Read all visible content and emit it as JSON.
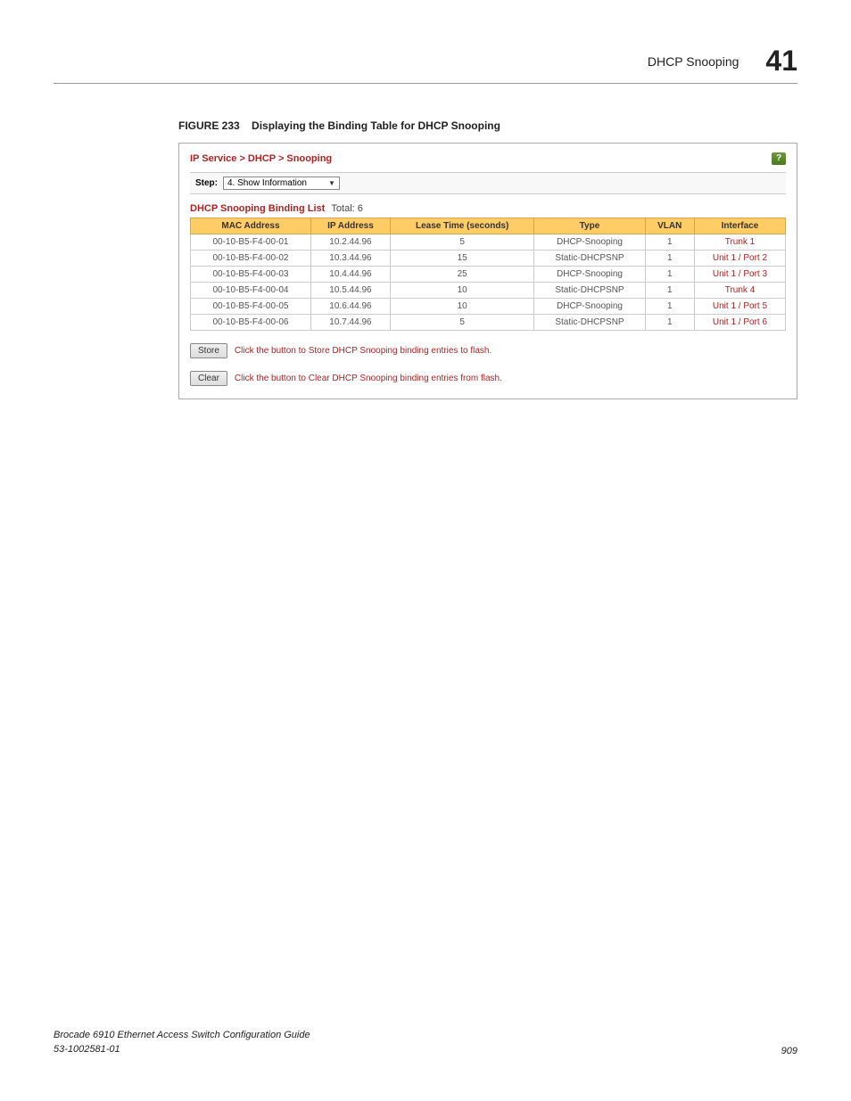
{
  "header": {
    "title": "DHCP Snooping",
    "chapter": "41"
  },
  "figure": {
    "label": "FIGURE 233",
    "caption": "Displaying the Binding Table for DHCP Snooping"
  },
  "panel": {
    "breadcrumb": "IP Service > DHCP > Snooping",
    "help_icon": "?",
    "step_label": "Step:",
    "step_value": "4. Show Information",
    "list_title": "DHCP Snooping Binding List",
    "list_total": "Total: 6",
    "columns": {
      "mac": "MAC Address",
      "ip": "IP Address",
      "lease": "Lease Time (seconds)",
      "type": "Type",
      "vlan": "VLAN",
      "iface": "Interface"
    },
    "rows": [
      {
        "mac": "00-10-B5-F4-00-01",
        "ip": "10.2.44.96",
        "lease": "5",
        "type": "DHCP-Snooping",
        "vlan": "1",
        "iface": "Trunk 1"
      },
      {
        "mac": "00-10-B5-F4-00-02",
        "ip": "10.3.44.96",
        "lease": "15",
        "type": "Static-DHCPSNP",
        "vlan": "1",
        "iface": "Unit 1 / Port 2"
      },
      {
        "mac": "00-10-B5-F4-00-03",
        "ip": "10.4.44.96",
        "lease": "25",
        "type": "DHCP-Snooping",
        "vlan": "1",
        "iface": "Unit 1 / Port 3"
      },
      {
        "mac": "00-10-B5-F4-00-04",
        "ip": "10.5.44.96",
        "lease": "10",
        "type": "Static-DHCPSNP",
        "vlan": "1",
        "iface": "Trunk 4"
      },
      {
        "mac": "00-10-B5-F4-00-05",
        "ip": "10.6.44.96",
        "lease": "10",
        "type": "DHCP-Snooping",
        "vlan": "1",
        "iface": "Unit 1 / Port 5"
      },
      {
        "mac": "00-10-B5-F4-00-06",
        "ip": "10.7.44.96",
        "lease": "5",
        "type": "Static-DHCPSNP",
        "vlan": "1",
        "iface": "Unit 1 / Port 6"
      }
    ],
    "store_btn": "Store",
    "store_desc": "Click the button to Store DHCP Snooping binding entries to flash.",
    "clear_btn": "Clear",
    "clear_desc": "Click the button to Clear DHCP Snooping binding entries from flash."
  },
  "footer": {
    "line1": "Brocade 6910 Ethernet Access Switch Configuration Guide",
    "line2": "53-1002581-01",
    "page": "909"
  }
}
